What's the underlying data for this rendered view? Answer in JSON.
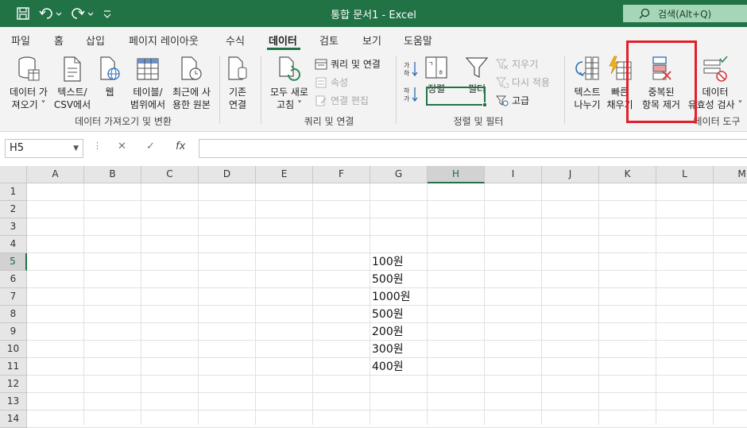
{
  "titlebar": {
    "title": "통합 문서1  -  Excel",
    "search_label": "검색(Alt+Q)",
    "icons": [
      "save-icon",
      "undo-icon",
      "redo-icon",
      "customize-qat-icon",
      "search-icon"
    ]
  },
  "tabs": [
    {
      "label": "파일"
    },
    {
      "label": "홈"
    },
    {
      "label": "삽입"
    },
    {
      "label": "페이지 레이아웃"
    },
    {
      "label": "수식"
    },
    {
      "label": "데이터",
      "active": true
    },
    {
      "label": "검토"
    },
    {
      "label": "보기"
    },
    {
      "label": "도움말"
    }
  ],
  "ribbon": {
    "get_transform": {
      "group_label": "데이터 가져오기 및 변환",
      "get_data": {
        "line1": "데이터 가",
        "line2": "져오기 ˅"
      },
      "from_text_csv": {
        "line1": "텍스트/",
        "line2": "CSV에서"
      },
      "from_web": {
        "line1": "웹"
      },
      "from_table": {
        "line1": "테이블/",
        "line2": "범위에서"
      },
      "recent_sources": {
        "line1": "최근에 사",
        "line2": "용한 원본"
      },
      "existing_connections": {
        "line1": "기존",
        "line2": "연결"
      }
    },
    "queries_connections": {
      "group_label": "쿼리 및 연결",
      "refresh_all": {
        "line1": "모두 새로",
        "line2": "고침 ˅"
      },
      "queries": "쿼리 및 연결",
      "properties": "속성",
      "edit_links": "연결 편집"
    },
    "sort_filter": {
      "group_label": "정렬 및 필터",
      "sort": "정렬",
      "filter": "필터",
      "clear": "지우기",
      "reapply": "다시 적용",
      "advanced": "고급"
    },
    "data_tools": {
      "group_label": "데이터 도구",
      "text_to_columns": {
        "line1": "텍스트",
        "line2": "나누기"
      },
      "flash_fill": {
        "line1": "빠른",
        "line2": "채우기"
      },
      "remove_duplicates": {
        "line1": "중복된",
        "line2": "항목 제거"
      },
      "data_validation": {
        "line1": "데이터",
        "line2": "유효성 검사 ˅"
      }
    },
    "highlight_color": "#e0202a"
  },
  "formula_bar": {
    "name_box": "H5",
    "formula": ""
  },
  "grid": {
    "columns": [
      "A",
      "B",
      "C",
      "D",
      "E",
      "F",
      "G",
      "H",
      "I",
      "J",
      "K",
      "L",
      "M"
    ],
    "rows": [
      "1",
      "2",
      "3",
      "4",
      "5",
      "6",
      "7",
      "8",
      "9",
      "10",
      "11",
      "12",
      "13",
      "14"
    ],
    "selected_column": "H",
    "selected_row": "5",
    "column_g_values": [
      {
        "row": "5",
        "value": "100원"
      },
      {
        "row": "6",
        "value": "500원"
      },
      {
        "row": "7",
        "value": "1000원"
      },
      {
        "row": "8",
        "value": "500원"
      },
      {
        "row": "9",
        "value": "200원"
      },
      {
        "row": "10",
        "value": "300원"
      },
      {
        "row": "11",
        "value": "400원"
      }
    ]
  },
  "colors": {
    "excel_green": "#217346",
    "search_box": "#a5d6b7",
    "ribbon_bg": "#f3f3f3"
  }
}
